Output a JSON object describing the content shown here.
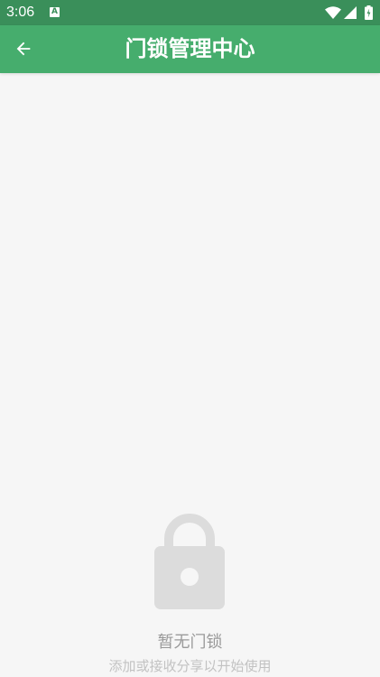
{
  "status_bar": {
    "time": "3:06",
    "notification_badge": "A",
    "icons": [
      "wifi-icon",
      "signal-icon",
      "battery-icon"
    ]
  },
  "app_bar": {
    "title": "门锁管理中心",
    "back_icon": "arrow-left-icon"
  },
  "empty_state": {
    "icon": "lock-icon",
    "title": "暂无门锁",
    "subtitle": "添加或接收分享以开始使用"
  },
  "colors": {
    "status_bar": "#3a8f5a",
    "app_bar": "#46ad6d",
    "background": "#f6f6f6",
    "icon_gray": "#dcdcdc",
    "title_gray": "#9a9a9a",
    "subtitle_gray": "#c2c2c2"
  }
}
